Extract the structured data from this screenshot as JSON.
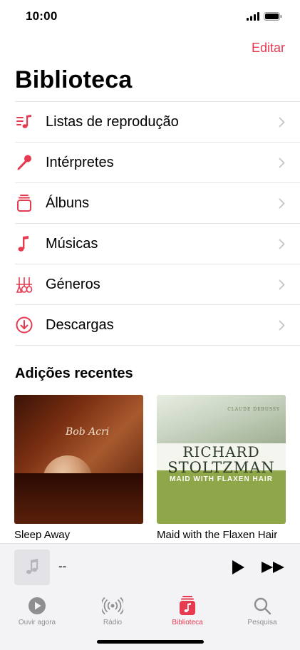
{
  "status_bar": {
    "time": "10:00"
  },
  "header": {
    "edit_label": "Editar",
    "title": "Biblioteca"
  },
  "library_items": [
    {
      "label": "Listas de reprodução",
      "icon": "playlist-icon"
    },
    {
      "label": "Intérpretes",
      "icon": "microphone-icon"
    },
    {
      "label": "Álbuns",
      "icon": "album-stack-icon"
    },
    {
      "label": "Músicas",
      "icon": "music-note-icon"
    },
    {
      "label": "Géneros",
      "icon": "instruments-icon"
    },
    {
      "label": "Descargas",
      "icon": "download-icon"
    }
  ],
  "recent": {
    "title": "Adições recentes",
    "albums": [
      {
        "title": "Sleep Away",
        "art_text": "Bob Acri"
      },
      {
        "title": "Maid with the Flaxen Hair",
        "art_composer": "CLAUDE DEBUSSY",
        "art_line1": "RICHARD",
        "art_line2": "STOLTZMAN",
        "art_line3": "MAID WITH FLAXEN HAIR"
      }
    ]
  },
  "mini_player": {
    "title": "--"
  },
  "tabs": [
    {
      "label": "Ouvir agora",
      "icon": "play-circle-icon",
      "active": false
    },
    {
      "label": "Rádio",
      "icon": "radio-icon",
      "active": false
    },
    {
      "label": "Biblioteca",
      "icon": "library-icon",
      "active": true
    },
    {
      "label": "Pesquisa",
      "icon": "search-icon",
      "active": false
    }
  ],
  "colors": {
    "accent": "#e63a51",
    "separator": "#e4e4e7",
    "tab_inactive": "#8e8e93"
  }
}
